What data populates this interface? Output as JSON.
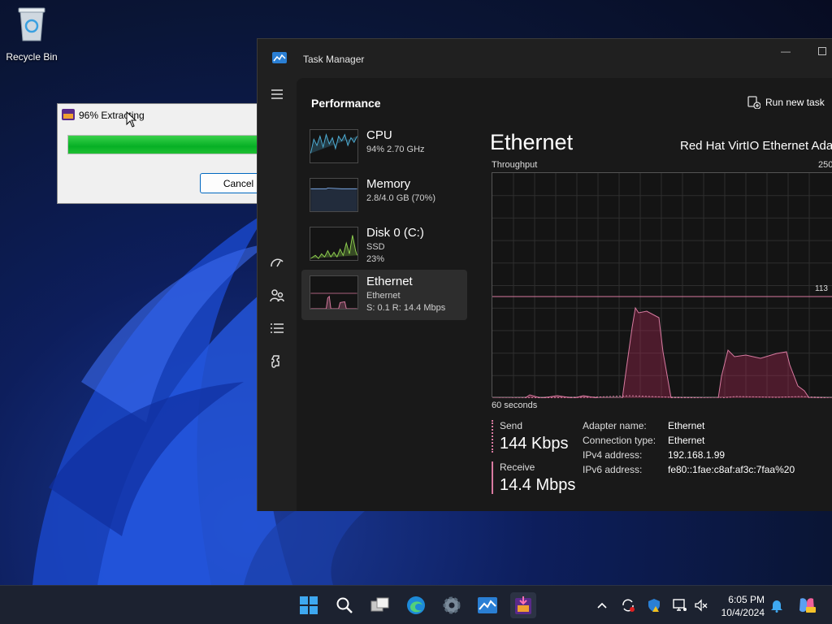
{
  "desktop": {
    "icons": [
      {
        "label": "Recycle Bin"
      }
    ]
  },
  "extract_dialog": {
    "title": "96% Extracting",
    "progress": 0.96,
    "cancel_label": "Cancel",
    "close_glyph": "✕"
  },
  "task_manager": {
    "title": "Task Manager",
    "section_title": "Performance",
    "run_new_task_label": "Run new task",
    "nav_icons": [
      "menu-icon",
      "startup-icon",
      "users-icon",
      "details-icon",
      "services-icon",
      "settings-icon"
    ],
    "perf_items": [
      {
        "name": "CPU",
        "sub1": "94% 2.70 GHz",
        "sub2": ""
      },
      {
        "name": "Memory",
        "sub1": "2.8/4.0 GB (70%)",
        "sub2": ""
      },
      {
        "name": "Disk 0 (C:)",
        "sub1": "SSD",
        "sub2": "23%"
      },
      {
        "name": "Ethernet",
        "sub1": "Ethernet",
        "sub2": "S: 0.1  R: 14.4 Mbps"
      }
    ],
    "detail": {
      "title": "Ethernet",
      "adapter_description": "Red Hat VirtIO Ethernet Ada",
      "throughput_label": "Throughput",
      "scale_max": "250",
      "line_label": "113",
      "time_label": "60 seconds",
      "send_label": "Send",
      "send_value": "144 Kbps",
      "receive_label": "Receive",
      "receive_value": "14.4 Mbps",
      "properties": [
        {
          "key": "Adapter name:",
          "value": "Ethernet"
        },
        {
          "key": "Connection type:",
          "value": "Ethernet"
        },
        {
          "key": "IPv4 address:",
          "value": "192.168.1.99"
        },
        {
          "key": "IPv6 address:",
          "value": "fe80::1fae:c8af:af3c:7faa%20"
        }
      ]
    }
  },
  "taskbar": {
    "apps": [
      "start-icon",
      "search-icon",
      "task-view-icon",
      "edge-icon",
      "settings-gear-icon",
      "task-manager-icon",
      "archiver-icon"
    ],
    "tray": [
      "chevron-up-icon",
      "sync-icon",
      "defender-icon",
      "network-icon",
      "volume-icon",
      "notification-icon",
      "copilot-icon"
    ],
    "time": "6:05 PM",
    "date": "10/4/2024"
  },
  "colors": {
    "accent_pink": "#d87aa0",
    "progress_green": "#06b025",
    "cpu_line": "#4fb0d8",
    "disk_line": "#8fd14f"
  }
}
